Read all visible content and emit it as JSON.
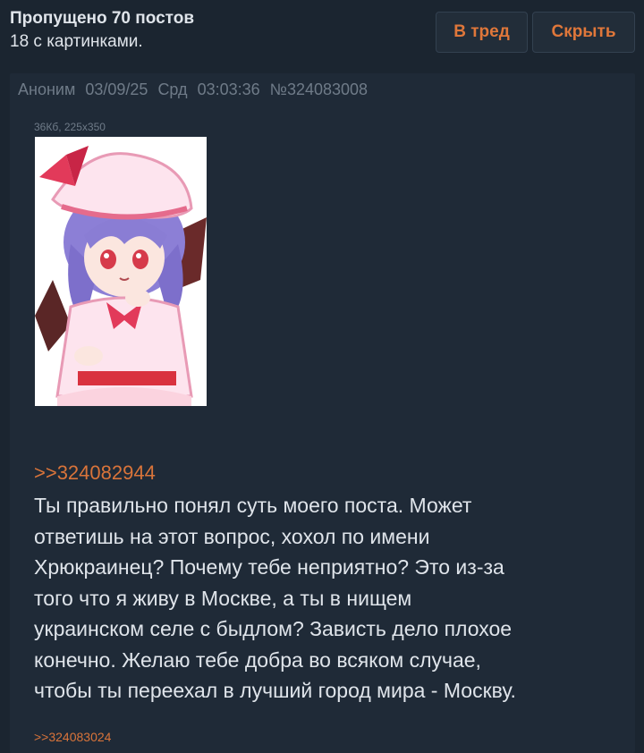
{
  "header": {
    "skipped_title": "Пропущено 70 постов",
    "skipped_subtitle": "18 с картинками.",
    "to_thread_label": "В тред",
    "hide_label": "Скрыть"
  },
  "post": {
    "author": "Аноним",
    "date": "03/09/25",
    "weekday": "Срд",
    "time": "03:03:36",
    "number": "№324083008",
    "file_info": "36Кб, 225x350",
    "reply_link": ">>324082944",
    "body_lines": [
      "Ты правильно понял суть моего поста. Может",
      "ответишь на этот вопрос, хохол по имени",
      "Хрюкраинец? Почему тебе неприятно? Это из-за",
      "того что я живу в Москве, а ты в нищем",
      "украинском селе с быдлом? Зависть дело плохое",
      "конечно. Желаю тебе добра во всяком случае,",
      "чтобы ты переехал в лучший город мира - Москву."
    ],
    "answer_link": ">>324083024"
  },
  "colors": {
    "background": "#1b2530",
    "post_background": "#1f2a37",
    "text": "#dfe4ea",
    "meta": "#6f7b88",
    "link": "#d9743a",
    "button_text": "#e0773a"
  },
  "icons": {
    "thumbnail": "anime-character-thumbnail"
  }
}
